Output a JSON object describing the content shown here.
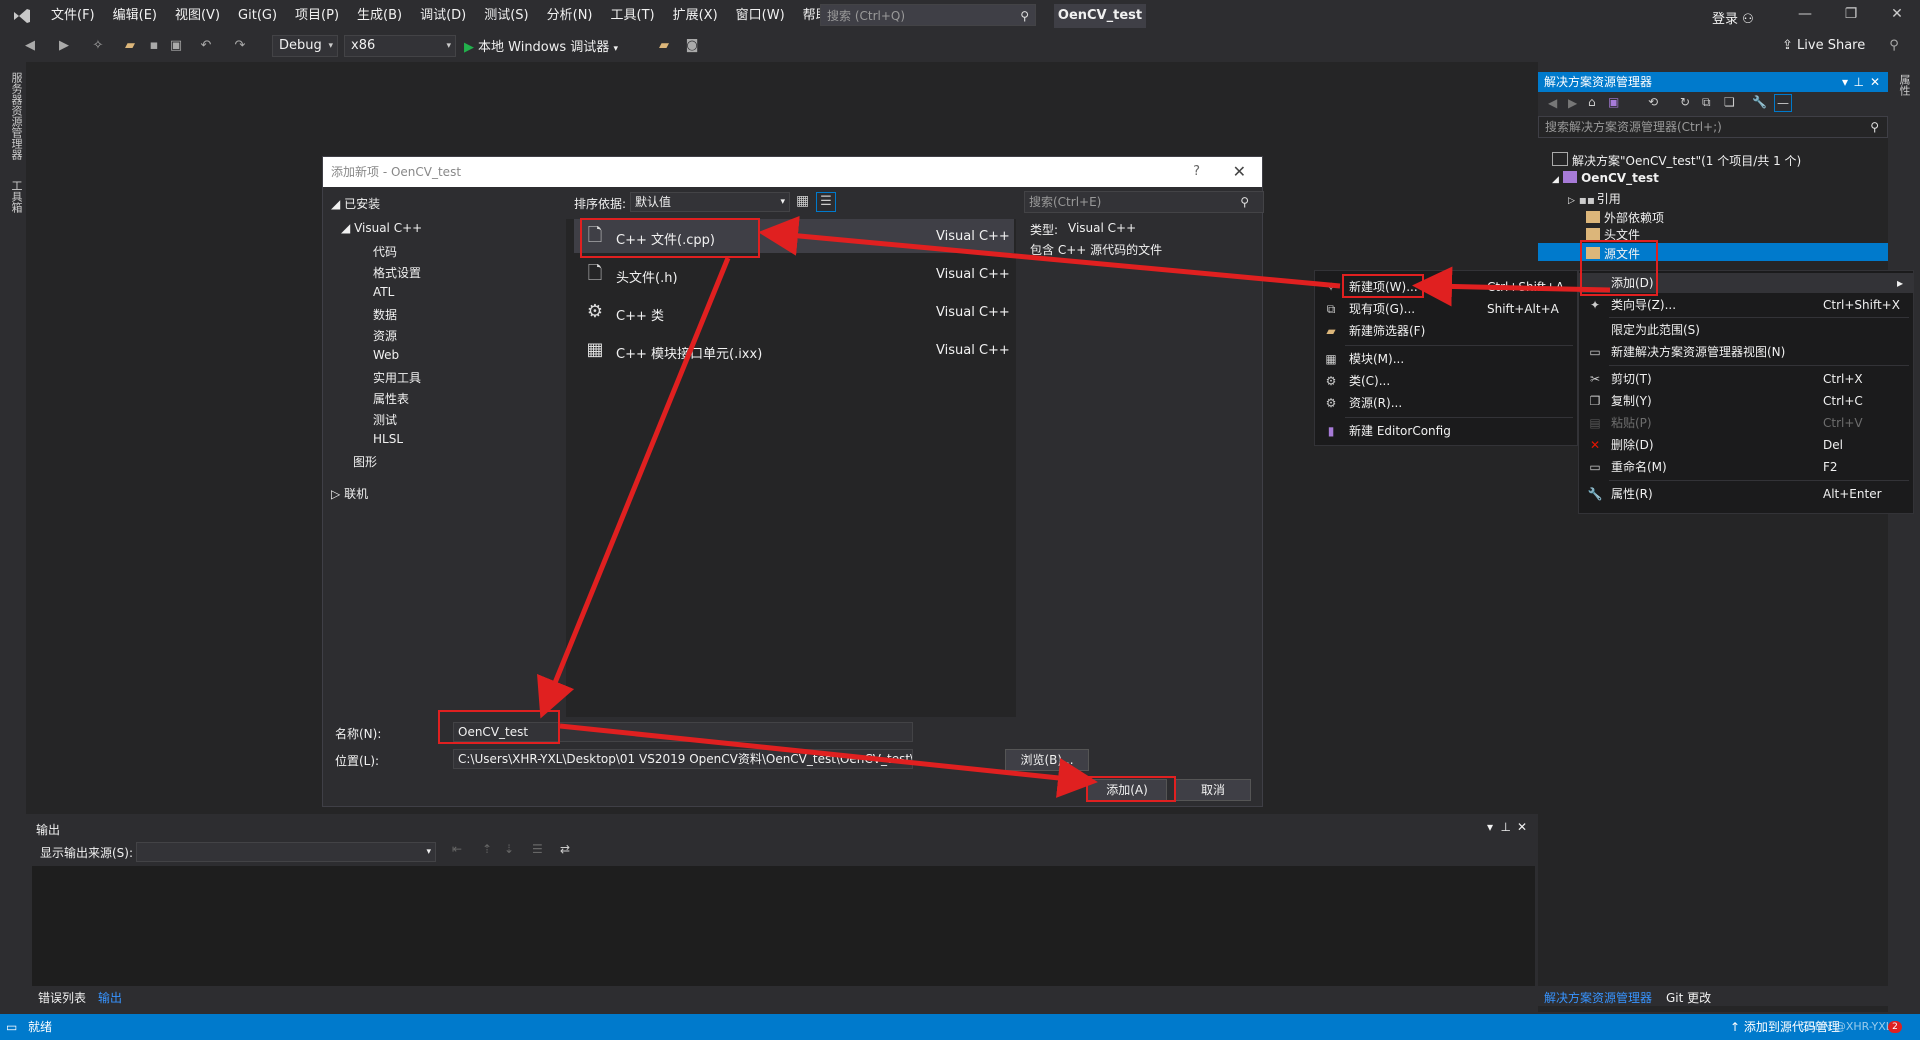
{
  "menubar": {
    "items": [
      "文件(F)",
      "编辑(E)",
      "视图(V)",
      "Git(G)",
      "项目(P)",
      "生成(B)",
      "调试(D)",
      "测试(S)",
      "分析(N)",
      "工具(T)",
      "扩展(X)",
      "窗口(W)",
      "帮助(H)"
    ],
    "search_placeholder": "搜索 (Ctrl+Q)",
    "project_title": "OenCV_test",
    "login": "登录"
  },
  "toolbar": {
    "config": "Debug",
    "platform": "x86",
    "run_label": "本地 Windows 调试器",
    "live_share": "Live Share"
  },
  "left_strip": {
    "server_explorer": "服务器资源管理器",
    "toolbox": "工具箱"
  },
  "dialog": {
    "title": "添加新项 - OenCV_test",
    "help": "?",
    "installed": "已安装",
    "tree": [
      "Visual C++",
      "代码",
      "格式设置",
      "ATL",
      "数据",
      "资源",
      "Web",
      "实用工具",
      "属性表",
      "测试",
      "HLSL",
      "图形",
      "联机"
    ],
    "sort_label": "排序依据:",
    "sort_value": "默认值",
    "search_placeholder": "搜索(Ctrl+E)",
    "templates": [
      {
        "name": "C++ 文件(.cpp)",
        "lang": "Visual C++"
      },
      {
        "name": "头文件(.h)",
        "lang": "Visual C++"
      },
      {
        "name": "C++ 类",
        "lang": "Visual C++"
      },
      {
        "name": "C++ 模块接口单元(.ixx)",
        "lang": "Visual C++"
      }
    ],
    "info_type_label": "类型:",
    "info_type_value": "Visual C++",
    "info_desc": "包含 C++ 源代码的文件",
    "name_label": "名称(N):",
    "name_value": "OenCV_test",
    "location_label": "位置(L):",
    "location_value": "C:\\Users\\XHR-YXL\\Desktop\\01 VS2019 OpenCV资料\\OenCV_test\\OenCV_test\\",
    "browse": "浏览(B)...",
    "add": "添加(A)",
    "cancel": "取消"
  },
  "solution": {
    "title": "解决方案资源管理器",
    "search_placeholder": "搜索解决方案资源管理器(Ctrl+;)",
    "root": "解决方案\"OenCV_test\"(1 个项目/共 1 个)",
    "project": "OenCV_test",
    "nodes": [
      "引用",
      "外部依赖项",
      "头文件",
      "源文件"
    ],
    "tab_solution": "解决方案资源管理器",
    "tab_git": "Git 更改"
  },
  "context_menu": {
    "items": [
      {
        "label": "添加(D)",
        "shortcut": ""
      },
      {
        "label": "类向导(Z)...",
        "shortcut": "Ctrl+Shift+X"
      },
      {
        "label": "限定为此范围(S)",
        "shortcut": ""
      },
      {
        "label": "新建解决方案资源管理器视图(N)",
        "shortcut": ""
      },
      {
        "label": "剪切(T)",
        "shortcut": "Ctrl+X"
      },
      {
        "label": "复制(Y)",
        "shortcut": "Ctrl+C"
      },
      {
        "label": "粘贴(P)",
        "shortcut": "Ctrl+V"
      },
      {
        "label": "删除(D)",
        "shortcut": "Del"
      },
      {
        "label": "重命名(M)",
        "shortcut": "F2"
      },
      {
        "label": "属性(R)",
        "shortcut": "Alt+Enter"
      }
    ]
  },
  "submenu": {
    "items": [
      {
        "label": "新建项(W)...",
        "shortcut": "Ctrl+Shift+A"
      },
      {
        "label": "现有项(G)...",
        "shortcut": "Shift+Alt+A"
      },
      {
        "label": "新建筛选器(F)",
        "shortcut": ""
      },
      {
        "label": "模块(M)...",
        "shortcut": ""
      },
      {
        "label": "类(C)...",
        "shortcut": ""
      },
      {
        "label": "资源(R)...",
        "shortcut": ""
      },
      {
        "label": "新建 EditorConfig",
        "shortcut": ""
      }
    ]
  },
  "output": {
    "title": "输出",
    "source_label": "显示输出来源(S):",
    "tab_errors": "错误列表",
    "tab_output": "输出"
  },
  "status": {
    "ready": "就绪",
    "source_control": "添加到源代码管理",
    "watermark": "CSDN @XHR-YXL",
    "notifications": "2"
  },
  "colors": {
    "accent": "#007acc",
    "annotation": "#e02020",
    "run": "#22b14c"
  }
}
